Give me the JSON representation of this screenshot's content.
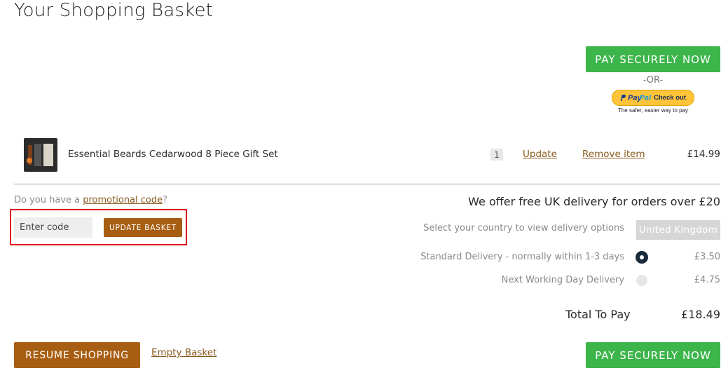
{
  "page_title": "Your Shopping Basket",
  "checkout": {
    "pay_label": "PAY SECURELY NOW",
    "or_label": "-OR-",
    "paypal_pay": "Pay",
    "paypal_pal": "Pal",
    "paypal_checkout": "Check out",
    "paypal_tagline": "The safer, easier way to pay"
  },
  "basket": {
    "items": [
      {
        "name": "Essential Beards Cedarwood 8 Piece Gift Set",
        "quantity": "1",
        "update_label": "Update",
        "remove_label": "Remove item",
        "price": "£14.99"
      }
    ]
  },
  "promo": {
    "question_prefix": "Do you have a ",
    "link_text": "promotional code",
    "question_suffix": "?",
    "placeholder": "Enter code",
    "update_basket_label": "UPDATE BASKET"
  },
  "delivery": {
    "free_uk_text": "We offer free UK delivery for orders over £20",
    "country_label": "Select your country to view delivery options",
    "country_value": "United Kingdom",
    "options": [
      {
        "label": "Standard Delivery - normally within 1-3 days",
        "price": "£3.50",
        "selected": true
      },
      {
        "label": "Next Working Day Delivery",
        "price": "£4.75",
        "selected": false
      }
    ]
  },
  "totals": {
    "label": "Total To Pay",
    "value": "£18.49"
  },
  "footer": {
    "resume_label": "RESUME SHOPPING",
    "empty_label": "Empty Basket"
  },
  "colors": {
    "pay_green": "#3cb54a",
    "brown": "#a85e12",
    "link_brown": "#8a5a1e",
    "highlight_red": "#e0141e"
  }
}
